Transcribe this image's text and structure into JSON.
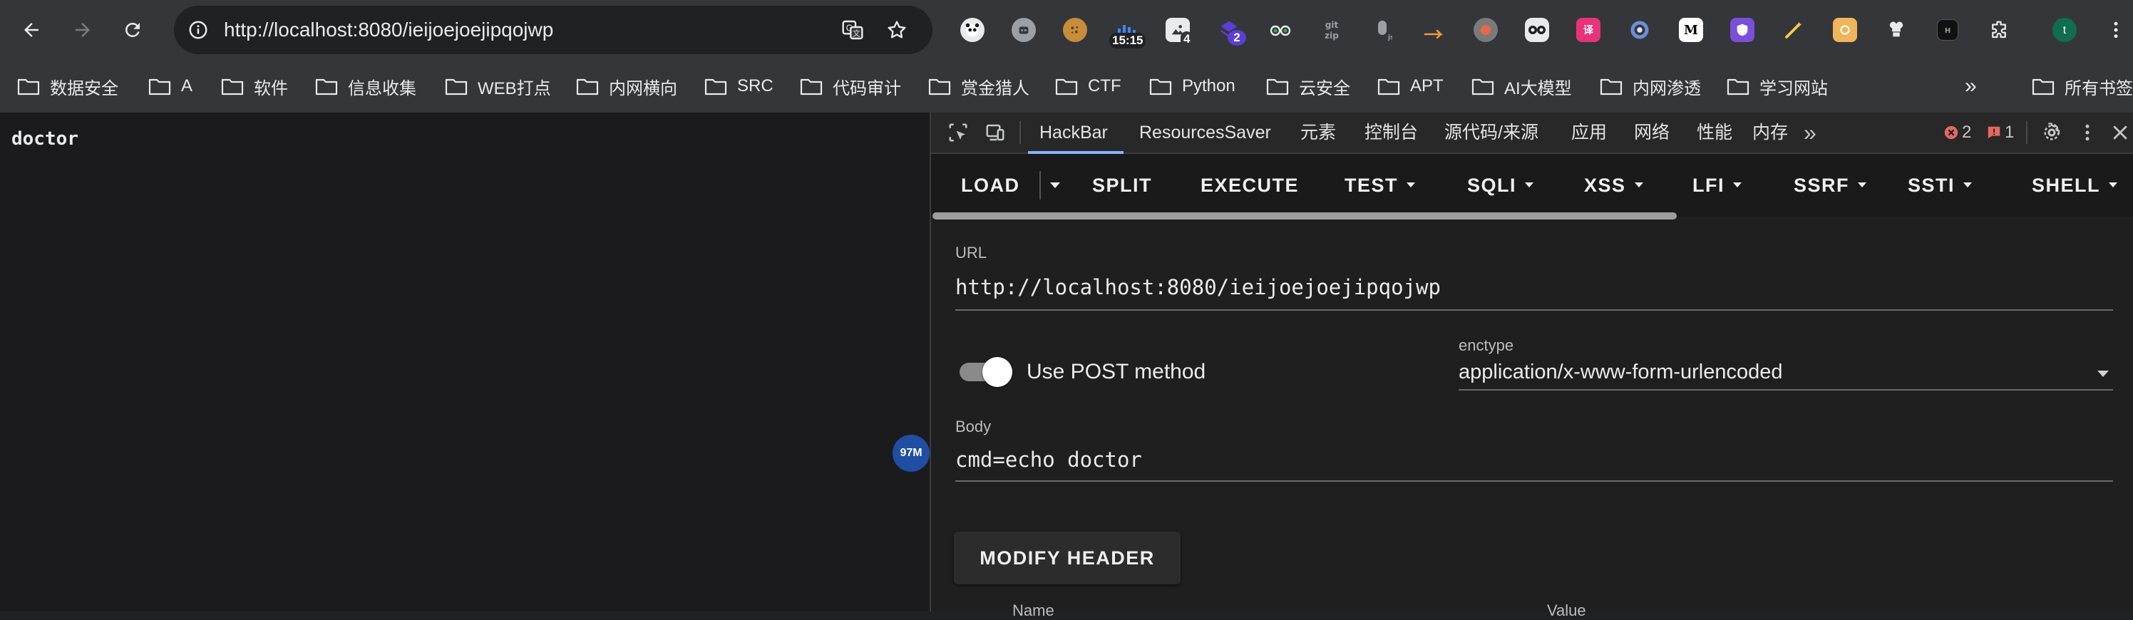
{
  "browser": {
    "url": "http://localhost:8080/ieijoejoejipqojwp",
    "extension_badges": {
      "clock": "15:15",
      "ext_a": "4",
      "ext_b": "2"
    },
    "bookmarks": [
      "数据安全",
      "A",
      "软件",
      "信息收集",
      "WEB打点",
      "内网横向",
      "SRC",
      "代码审计",
      "赏金猎人",
      "CTF",
      "Python",
      "云安全",
      "APT",
      "AI大模型",
      "内网渗透",
      "学习网站"
    ],
    "more_bookmarks": "»",
    "other_bookmarks": "所有书签"
  },
  "page": {
    "body_text": "doctor",
    "memory_badge": "97M"
  },
  "devtools": {
    "tabs": [
      "HackBar",
      "ResourcesSaver",
      "元素",
      "控制台",
      "源代码/来源",
      "应用",
      "网络",
      "性能",
      "内存"
    ],
    "active_tab": "HackBar",
    "overflow": "»",
    "error_count": "2",
    "warning_count": "1"
  },
  "hackbar": {
    "toolbar": {
      "load": "LOAD",
      "split": "SPLIT",
      "execute": "EXECUTE",
      "test": "TEST",
      "sqli": "SQLI",
      "xss": "XSS",
      "lfi": "LFI",
      "ssrf": "SSRF",
      "ssti": "SSTI",
      "shell": "SHELL"
    },
    "url_label": "URL",
    "url_value": "http://localhost:8080/ieijoejoejipqojwp",
    "post_label": "Use POST method",
    "post_enabled": true,
    "enctype_label": "enctype",
    "enctype_value": "application/x-www-form-urlencoded",
    "body_label": "Body",
    "body_value": "cmd=echo doctor",
    "modify_header": "MODIFY HEADER",
    "header_col_name": "Name",
    "header_col_value": "Value"
  },
  "colors": {
    "toolbar_bg": "#35363a",
    "devtools_bg": "#1f1f1f",
    "accent": "#8ab4f8",
    "error_red": "#e46962"
  }
}
